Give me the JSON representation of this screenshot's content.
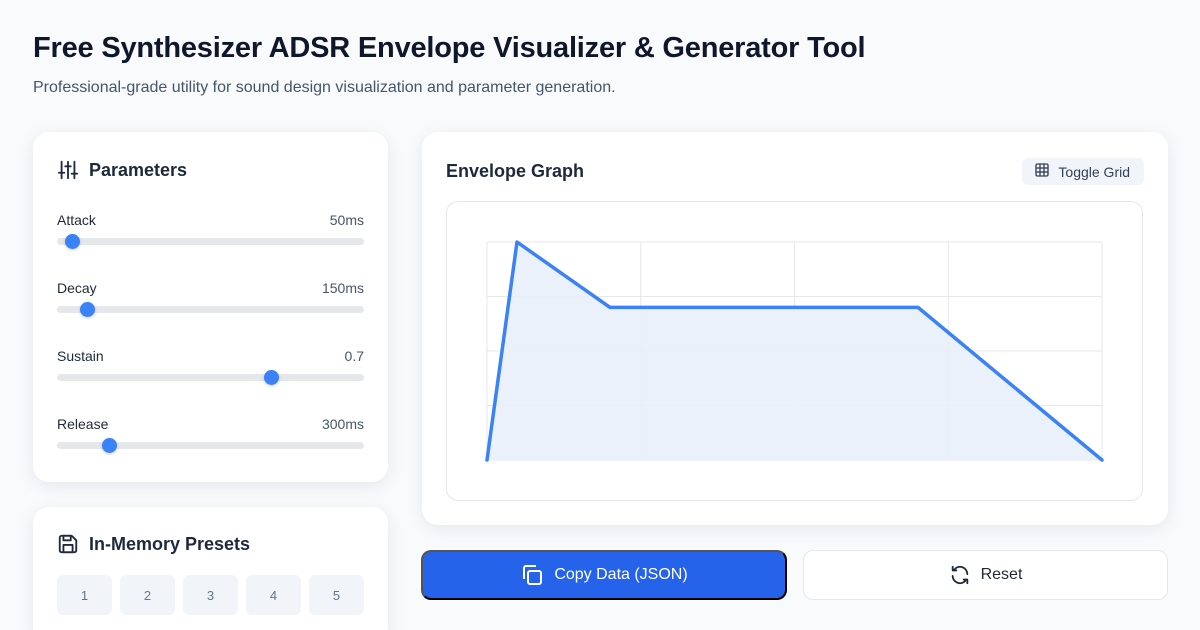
{
  "header": {
    "title": "Free Synthesizer ADSR Envelope Visualizer & Generator Tool",
    "subtitle": "Professional-grade utility for sound design visualization and parameter generation."
  },
  "parameters": {
    "heading": "Parameters",
    "icon": "sliders-icon",
    "items": [
      {
        "label": "Attack",
        "value": "50ms",
        "level": 0.05
      },
      {
        "label": "Decay",
        "value": "150ms",
        "level": 0.1
      },
      {
        "label": "Sustain",
        "value": "0.7",
        "level": 0.7
      },
      {
        "label": "Release",
        "value": "300ms",
        "level": 0.17
      }
    ]
  },
  "graph": {
    "heading": "Envelope Graph",
    "toggle_label": "Toggle Grid",
    "toggle_icon": "grid-icon",
    "grid": true,
    "line_color": "#3b82f6",
    "fill_color": "#e8effb"
  },
  "presets": {
    "heading": "In-Memory Presets",
    "icon": "save-icon",
    "slots": [
      "1",
      "2",
      "3",
      "4",
      "5"
    ]
  },
  "actions": {
    "copy_label": "Copy Data (JSON)",
    "copy_icon": "copy-icon",
    "reset_label": "Reset",
    "reset_icon": "refresh-icon"
  },
  "colors": {
    "accent": "#3b82f6",
    "primary_button": "#2563eb"
  }
}
